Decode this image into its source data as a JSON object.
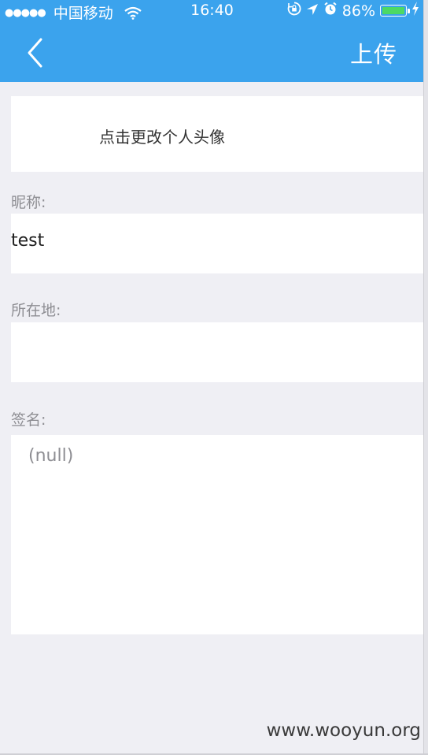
{
  "status_bar": {
    "signal_dots": "●●●●●",
    "carrier": "中国移动",
    "time": "16:40",
    "battery_percent": "86%",
    "battery_level": 0.86,
    "icons": [
      "signal-dots-icon",
      "wifi-icon",
      "rotation-lock-icon",
      "location-arrow-icon",
      "alarm-icon",
      "battery-icon",
      "charging-bolt-icon"
    ]
  },
  "nav": {
    "back_icon": "chevron-left-icon",
    "upload_label": "上传",
    "background_color": "#3ba3ed"
  },
  "avatar": {
    "label": "点击更改个人头像"
  },
  "form": {
    "nickname_label": "昵称:",
    "nickname_value": "test",
    "location_label": "所在地:",
    "location_value": "",
    "signature_label": "签名:",
    "signature_value": "(null)"
  },
  "watermark": "www.wooyun.org"
}
